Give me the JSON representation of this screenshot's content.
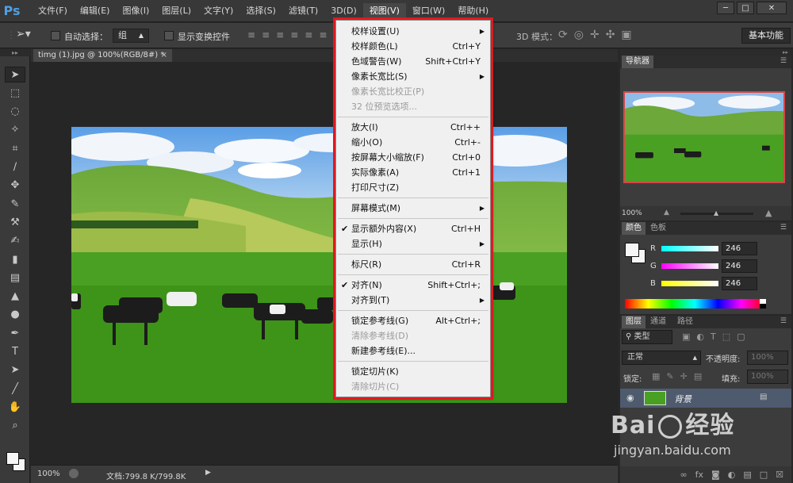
{
  "app": {
    "logo": "Ps"
  },
  "menubar": [
    "文件(F)",
    "编辑(E)",
    "图像(I)",
    "图层(L)",
    "文字(Y)",
    "选择(S)",
    "滤镜(T)",
    "3D(D)",
    "视图(V)",
    "窗口(W)",
    "帮助(H)"
  ],
  "window_controls": [
    "minimize-icon",
    "maximize-icon",
    "close-icon"
  ],
  "options": {
    "auto_select_label": "自动选择：",
    "auto_select_value": "组",
    "show_transform_label": "显示变换控件",
    "mode_3d_label": "3D 模式：",
    "workspace": "基本功能"
  },
  "document": {
    "tab": "timg (1).jpg @ 100%(RGB/8#) *"
  },
  "status": {
    "zoom": "100%",
    "doc": "文档:799.8 K/799.8K"
  },
  "view_menu": [
    {
      "label": "校样设置(U)",
      "shortcut": "",
      "submenu": true,
      "disabled": false
    },
    {
      "label": "校样颜色(L)",
      "shortcut": "Ctrl+Y",
      "submenu": false,
      "disabled": false
    },
    {
      "label": "色域警告(W)",
      "shortcut": "Shift+Ctrl+Y",
      "submenu": false,
      "disabled": false
    },
    {
      "label": "像素长宽比(S)",
      "shortcut": "",
      "submenu": true,
      "disabled": false
    },
    {
      "label": "像素长宽比校正(P)",
      "shortcut": "",
      "submenu": false,
      "disabled": true
    },
    {
      "label": "32 位预览选项...",
      "shortcut": "",
      "submenu": false,
      "disabled": true
    },
    {
      "label": "放大(I)",
      "shortcut": "Ctrl++",
      "submenu": false,
      "disabled": false
    },
    {
      "label": "缩小(O)",
      "shortcut": "Ctrl+-",
      "submenu": false,
      "disabled": false
    },
    {
      "label": "按屏幕大小缩放(F)",
      "shortcut": "Ctrl+0",
      "submenu": false,
      "disabled": false
    },
    {
      "label": "实际像素(A)",
      "shortcut": "Ctrl+1",
      "submenu": false,
      "disabled": false
    },
    {
      "label": "打印尺寸(Z)",
      "shortcut": "",
      "submenu": false,
      "disabled": false
    },
    {
      "label": "屏幕模式(M)",
      "shortcut": "",
      "submenu": true,
      "disabled": false
    },
    {
      "label": "显示额外内容(X)",
      "shortcut": "Ctrl+H",
      "submenu": false,
      "disabled": false,
      "checked": true
    },
    {
      "label": "显示(H)",
      "shortcut": "",
      "submenu": true,
      "disabled": false
    },
    {
      "label": "标尺(R)",
      "shortcut": "Ctrl+R",
      "submenu": false,
      "disabled": false
    },
    {
      "label": "对齐(N)",
      "shortcut": "Shift+Ctrl+;",
      "submenu": false,
      "disabled": false,
      "checked": true
    },
    {
      "label": "对齐到(T)",
      "shortcut": "",
      "submenu": true,
      "disabled": false
    },
    {
      "label": "锁定参考线(G)",
      "shortcut": "Alt+Ctrl+;",
      "submenu": false,
      "disabled": false
    },
    {
      "label": "清除参考线(D)",
      "shortcut": "",
      "submenu": false,
      "disabled": true
    },
    {
      "label": "新建参考线(E)...",
      "shortcut": "",
      "submenu": false,
      "disabled": false
    },
    {
      "label": "锁定切片(K)",
      "shortcut": "",
      "submenu": false,
      "disabled": false
    },
    {
      "label": "清除切片(C)",
      "shortcut": "",
      "submenu": false,
      "disabled": true
    }
  ],
  "navigator": {
    "title": "导航器",
    "zoom": "100%"
  },
  "color_panel": {
    "tabs": [
      "颜色",
      "色板"
    ],
    "r_label": "R",
    "g_label": "G",
    "b_label": "B",
    "r": "246",
    "g": "246",
    "b": "246"
  },
  "layers_panel": {
    "tabs": [
      "图层",
      "通道",
      "路径"
    ],
    "filter": "类型",
    "blend_mode": "正常",
    "opacity_label": "不透明度:",
    "opacity": "100%",
    "lock_label": "锁定:",
    "fill_label": "填充:",
    "fill": "100%",
    "layer_name": "背景"
  },
  "watermark": {
    "line1": "Bai",
    "line2": "经验",
    "url": "jingyan.baidu.com"
  }
}
